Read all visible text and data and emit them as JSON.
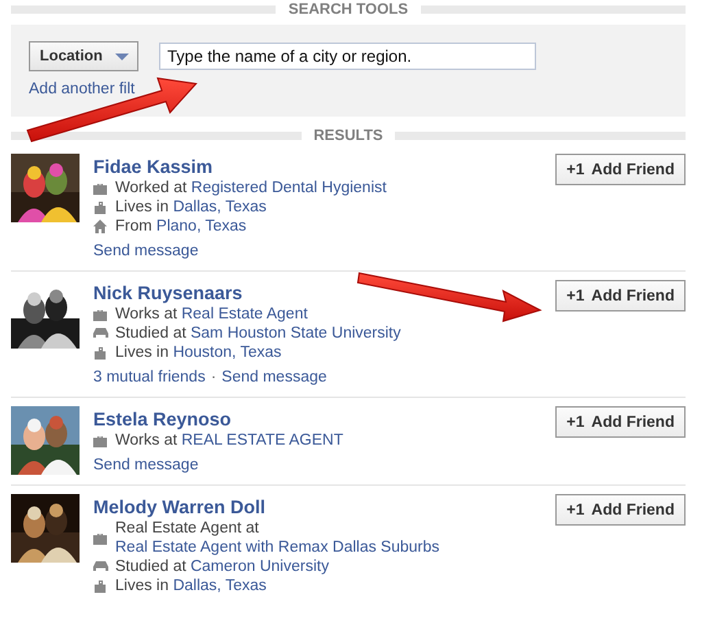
{
  "search_tools": {
    "heading": "SEARCH TOOLS",
    "filter_button": "Location",
    "location_field": {
      "placeholder": "Type the name of a city or region."
    },
    "add_filter_link": "Add another filt"
  },
  "results": {
    "heading": "RESULTS",
    "rows": [
      {
        "name": "Fidae Kassim",
        "button": {
          "icon": "+1",
          "label": "Add Friend"
        },
        "details": [
          {
            "kind": "work",
            "text": "Worked at",
            "link": "Registered Dental Hygienist"
          },
          {
            "kind": "lives",
            "text": "Lives in",
            "link": "Dallas, Texas"
          },
          {
            "kind": "from",
            "text": "From",
            "link": "Plano, Texas"
          }
        ],
        "footer": [
          {
            "kind": "link",
            "text": "Send message"
          }
        ]
      },
      {
        "name": "Nick Ruysenaars",
        "button": {
          "icon": "+1",
          "label": "Add Friend"
        },
        "details": [
          {
            "kind": "work",
            "text": "Works at",
            "link": "Real Estate Agent"
          },
          {
            "kind": "study",
            "text": "Studied at",
            "link": "Sam Houston State University"
          },
          {
            "kind": "lives",
            "text": "Lives in",
            "link": "Houston, Texas"
          }
        ],
        "footer": [
          {
            "kind": "link",
            "text": "3 mutual friends"
          },
          {
            "kind": "separator",
            "text": "·"
          },
          {
            "kind": "link",
            "text": "Send message"
          }
        ]
      },
      {
        "name": "Estela Reynoso",
        "button": {
          "icon": "+1",
          "label": "Add Friend"
        },
        "details": [
          {
            "kind": "work",
            "text": "Works at",
            "link": "REAL ESTATE AGENT"
          }
        ],
        "footer": [
          {
            "kind": "link",
            "text": "Send message"
          }
        ]
      },
      {
        "name": "Melody Warren Doll",
        "button": {
          "icon": "+1",
          "label": "Add Friend"
        },
        "details": [
          {
            "kind": "work",
            "text": "Real Estate Agent at",
            "link": "Real Estate Agent with Remax Dallas Suburbs"
          },
          {
            "kind": "study",
            "text": "Studied at",
            "link": "Cameron University"
          },
          {
            "kind": "lives",
            "text": "Lives in",
            "link": "Dallas, Texas"
          }
        ]
      }
    ]
  }
}
